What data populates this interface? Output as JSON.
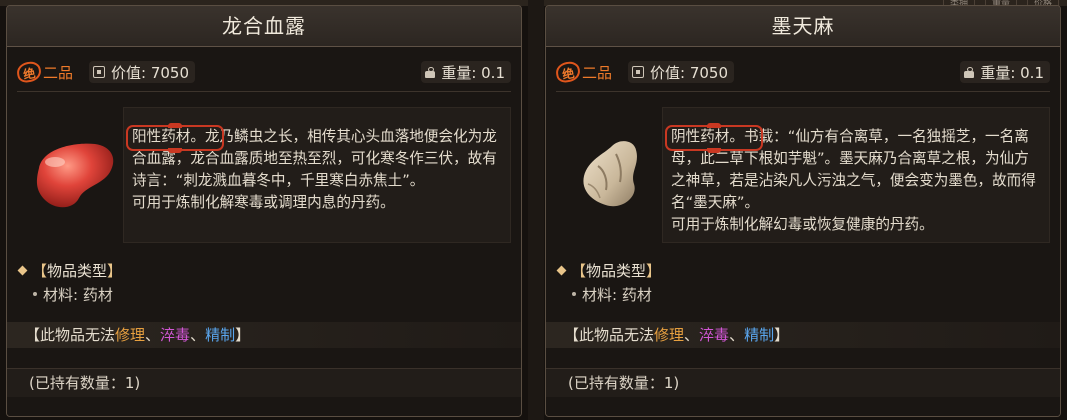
{
  "top_tabs": [
    "类拥",
    "重量",
    "价格"
  ],
  "cards": [
    {
      "title": "龙合血露",
      "grade_badge": "绝",
      "grade": "二品",
      "price": "价值: 7050",
      "weight": "重量: 0.1",
      "item_icon": "red-blood-dew",
      "tag": "阳性药材",
      "desc_rest": "。龙乃鳞虫之长，相传其心头血落地便会化为龙合血露，龙合血露质地至热至烈，可化寒冬作三伏，故有诗言：“刺龙溅血暮冬中，千里寒白赤焦土”。",
      "desc_use": "可用于炼制化解寒毒或调理内息的丹药。",
      "type_label": "物品类型",
      "material_label": "材料:",
      "material_value": "药材",
      "restrict_prefix": "【此物品无法",
      "restrict_items": [
        "修理",
        "淬毒",
        "精制"
      ],
      "restrict_suffix": "】",
      "owned": "(已持有数量：1)"
    },
    {
      "title": "墨天麻",
      "grade_badge": "绝",
      "grade": "二品",
      "price": "价值: 7050",
      "weight": "重量: 0.1",
      "item_icon": "tianma-root",
      "tag": "阴性药材",
      "desc_rest": "。书载：“仙方有合离草，一名独摇芝，一名离母，此二草下根如芋魁”。墨天麻乃合离草之根，为仙方之神草，若是沾染凡人污浊之气，便会变为墨色，故而得名“墨天麻”。",
      "desc_use": "可用于炼制化解幻毒或恢复健康的丹药。",
      "type_label": "物品类型",
      "material_label": "材料:",
      "material_value": "药材",
      "restrict_prefix": "【此物品无法",
      "restrict_items": [
        "修理",
        "淬毒",
        "精制"
      ],
      "restrict_suffix": "】",
      "owned": "(已持有数量：1)"
    }
  ],
  "colors": {
    "grade": "#ef7a2a",
    "tag_frame": "#c93822",
    "repair": "#e7a040",
    "poison": "#d257d6",
    "refine": "#5aa6ee"
  }
}
